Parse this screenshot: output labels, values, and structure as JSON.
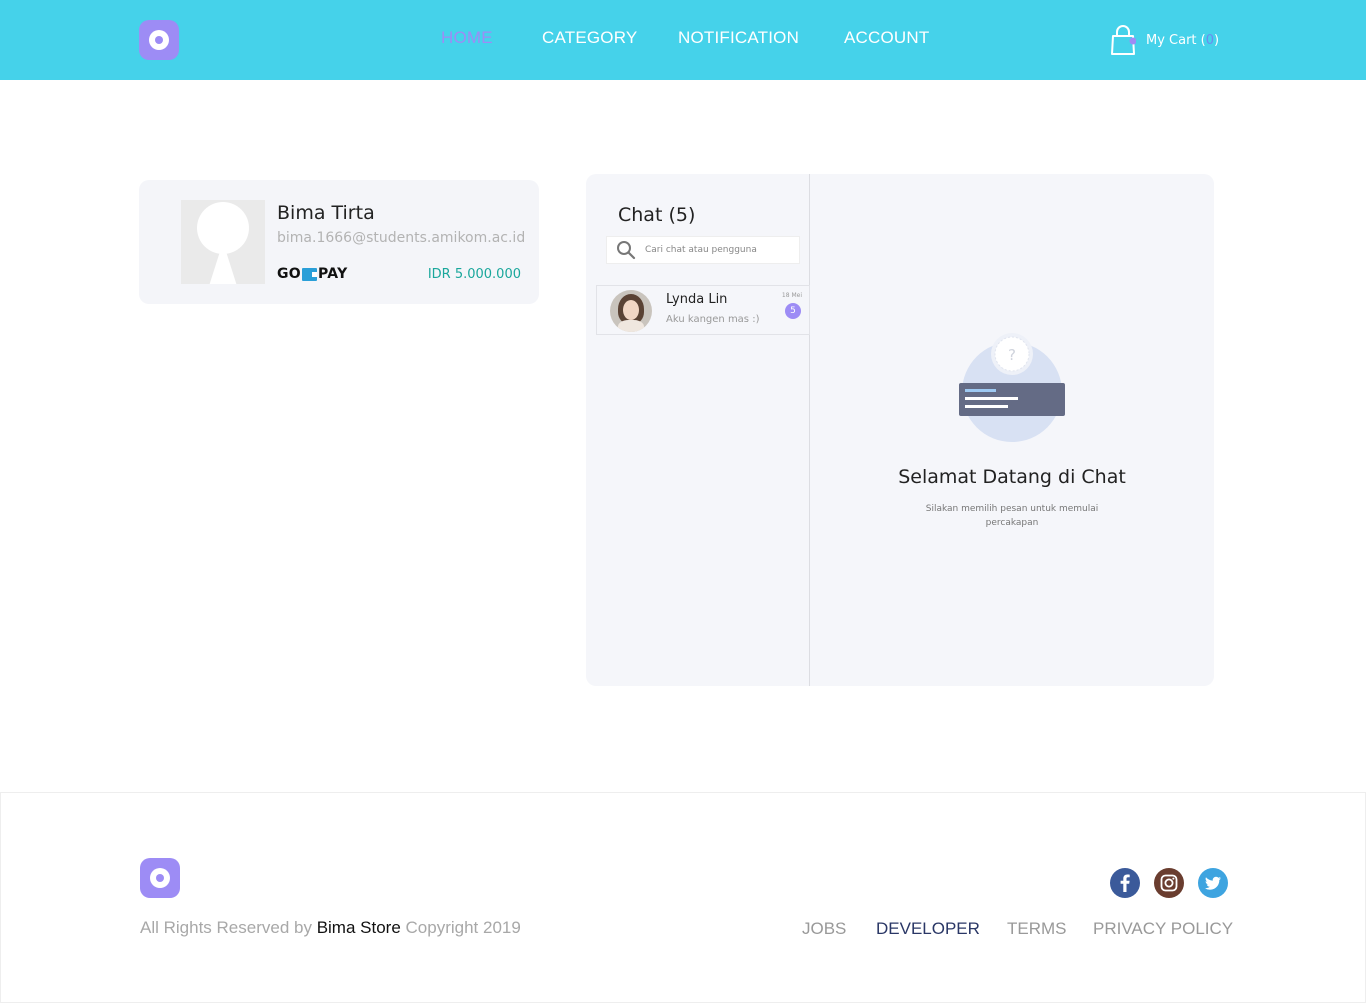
{
  "header": {
    "nav": [
      "HOME",
      "CATEGORY",
      "NOTIFICATION",
      "ACCOUNT"
    ],
    "cart_label": "My Cart (",
    "cart_count": "0",
    "cart_close": ")"
  },
  "profile": {
    "name": "Bima Tirta",
    "email": "bima.1666@students.amikom.ac.id",
    "wallet_go": "GO",
    "wallet_pay": "PAY",
    "balance": "IDR 5.000.000"
  },
  "chat": {
    "title": "Chat (5)",
    "search_placeholder": "Cari chat atau pengguna",
    "items": [
      {
        "name": "Lynda Lin",
        "preview": "Aku kangen mas :)",
        "date": "18 Mei",
        "unread": "5"
      }
    ],
    "welcome_title": "Selamat Datang di Chat",
    "welcome_sub": "Silakan memilih pesan untuk memulai percakapan"
  },
  "footer": {
    "copyright_prefix": "All Rights Reserved by ",
    "brand": "Bima Store",
    "copyright_suffix": " Copyright 2019",
    "links": [
      "JOBS",
      "DEVELOPER",
      "TERMS",
      "PRIVACY POLICY"
    ],
    "social": [
      "facebook-icon",
      "instagram-icon",
      "twitter-icon"
    ]
  },
  "colors": {
    "header_bg": "#45d2ea",
    "accent": "#9d8cf5",
    "balance": "#1aa79c"
  }
}
